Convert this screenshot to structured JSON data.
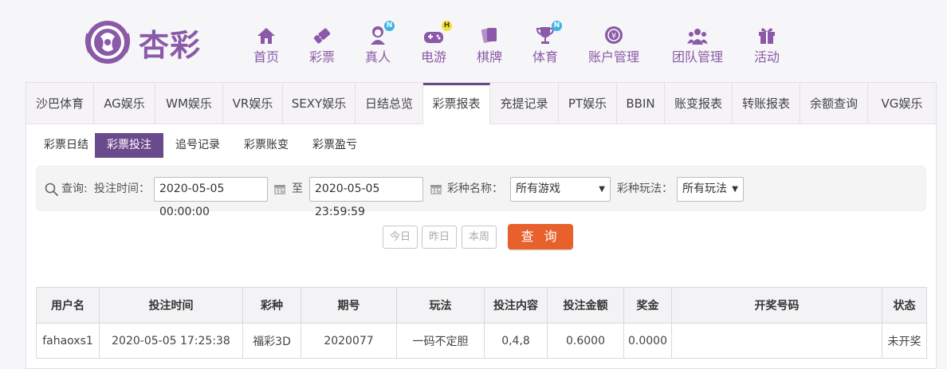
{
  "brand": {
    "name": "杏彩"
  },
  "nav": [
    {
      "label": "首页",
      "icon": "home-icon",
      "badge": ""
    },
    {
      "label": "彩票",
      "icon": "ticket-icon",
      "badge": ""
    },
    {
      "label": "真人",
      "icon": "dealer-icon",
      "badge": "N"
    },
    {
      "label": "电游",
      "icon": "gamepad-icon",
      "badge": "H"
    },
    {
      "label": "棋牌",
      "icon": "cards-icon",
      "badge": ""
    },
    {
      "label": "体育",
      "icon": "trophy-icon",
      "badge": "N"
    },
    {
      "label": "账户管理",
      "icon": "account-icon",
      "badge": ""
    },
    {
      "label": "团队管理",
      "icon": "team-icon",
      "badge": ""
    },
    {
      "label": "活动",
      "icon": "gift-icon",
      "badge": ""
    }
  ],
  "tabs": [
    "沙巴体育",
    "AG娱乐",
    "WM娱乐",
    "VR娱乐",
    "SEXY娱乐",
    "日结总览",
    "彩票报表",
    "充提记录",
    "PT娱乐",
    "BBIN",
    "账变报表",
    "转账报表",
    "余额查询",
    "VG娱乐"
  ],
  "active_tab": "彩票报表",
  "subtabs": [
    "彩票日结",
    "彩票投注",
    "追号记录",
    "彩票账变",
    "彩票盈亏"
  ],
  "active_subtab": "彩票投注",
  "search": {
    "query_label": "查询:",
    "time_label": "投注时间：",
    "start_time": "2020-05-05 00:00:00",
    "to_label": "至",
    "end_time": "2020-05-05 23:59:59",
    "game_label": "彩种名称：",
    "game_value": "所有游戏",
    "play_label": "彩种玩法：",
    "play_value": "所有玩法"
  },
  "quick": {
    "today": "今日",
    "yesterday": "昨日",
    "week": "本周"
  },
  "query_button": "查 询",
  "table": {
    "headers": [
      "用户名",
      "投注时间",
      "彩种",
      "期号",
      "玩法",
      "投注内容",
      "投注金额",
      "奖金",
      "开奖号码",
      "状态"
    ],
    "rows": [
      [
        "fahaoxs1",
        "2020-05-05 17:25:38",
        "福彩3D",
        "2020077",
        "一码不定胆",
        "0,4,8",
        "0.6000",
        "0.0000",
        "",
        "未开奖"
      ]
    ]
  },
  "colors": {
    "brand": "#8a5aa8",
    "active": "#6b4a8c",
    "query": "#e8612c",
    "status_pending": "#2f9a2f"
  }
}
